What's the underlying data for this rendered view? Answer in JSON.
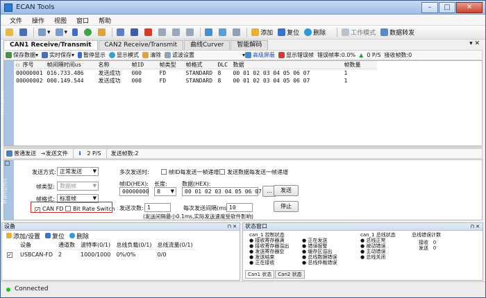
{
  "window": {
    "title": "ECAN Tools",
    "min": "–",
    "max": "□",
    "close": "✕"
  },
  "menu": [
    "文件",
    "操作",
    "视图",
    "窗口",
    "帮助"
  ],
  "toolbar": {
    "add": "添加",
    "reset": "复位",
    "delete": "删除",
    "work_mode": "工作模式",
    "data_forward": "数据转发"
  },
  "tabs": [
    "CAN1 Receive/Transmit",
    "CAN2 Receive/Transmit",
    "曲线Curver",
    "智能解码"
  ],
  "tabs_close": "▾ ✕",
  "recv_toolbar": {
    "save_data": "保存数据",
    "realtime_save": "实时保存",
    "pause": "暂停显示",
    "display_mode": "显示模式",
    "clear": "清除",
    "filter": "滤波设置",
    "advanced": "高级屏蔽",
    "show_error": "显示错误帧",
    "error_rate": "错误帧率:0.0%",
    "fps": "0 P/S",
    "recv_count": "接收帧数:0"
  },
  "recv_side": "Receive",
  "recv_table": {
    "headers": [
      "序号",
      "帧间隔时间us",
      "名称",
      "帧ID",
      "帧类型",
      "帧格式",
      "DLC",
      "数据",
      "帧数量"
    ],
    "rows": [
      [
        "00000001",
        "016.733.486",
        "发送成功",
        "000",
        "FD",
        "STANDARD",
        "8",
        "00 01 02 03 04 05 06 07",
        "1"
      ],
      [
        "00000002",
        "000.149.544",
        "发送成功",
        "000",
        "FD",
        "STANDARD",
        "8",
        "00 01 02 03 04 05 06 07",
        "1"
      ]
    ]
  },
  "send_toolbar": {
    "normal_send": "普通发送",
    "send_file": "发送文件",
    "rate": "2 P/S",
    "sent_count": "发送帧数:2"
  },
  "send_side": "Transmit",
  "send": {
    "mode_label": "发送方式:",
    "mode_value": "正常发送",
    "frame_type_label": "帧类型:",
    "frame_type_value": "数据帧",
    "frame_format_label": "帧格式:",
    "frame_format_value": "标准帧",
    "canfd_label": "CAN FD",
    "brs_label": "Bit Rate Switch",
    "multi_label": "多次发送时:",
    "id_inc_label": "帧ID每发送一帧递增",
    "data_inc_label": "发送数据每发送一帧递增",
    "frame_id_label": "帧ID(HEX):",
    "frame_id_value": "00000000",
    "length_label": "长度:",
    "length_value": "8",
    "data_label": "数据(HEX):",
    "data_value": "00 01 02 03 04 05 06 07",
    "ellipsis": "...",
    "send_button": "发送",
    "count_label": "发送次数:",
    "count_value": "1",
    "interval_label": "每次发送间隔(ms)",
    "interval_value": "10",
    "stop_button": "停止",
    "hint": "(发送间隔最小0.1ms,实际发送速度受软件影响)"
  },
  "device_panel": {
    "title": "设备",
    "add_settings": "添加/设置",
    "reset": "复位",
    "delete": "删除",
    "headers": [
      "设备",
      "通道数",
      "波特率(0/1)",
      "总线负载(0/1)",
      "总线流量(0/1)"
    ],
    "rows": [
      [
        "USBCAN-FD",
        "2",
        "1000/1000",
        "0%/0%",
        "0/0"
      ]
    ]
  },
  "status_panel": {
    "title": "状态窗口",
    "col1_title": "can_1 控制状态",
    "col1": [
      "● 接收寄存器满",
      "● 接收寄存器溢出",
      "● 发送寄存器空",
      "● 发送结束",
      "● 正在接收"
    ],
    "col2": [
      "● 正在发送",
      "● 错误报警",
      "● 缓存区溢出",
      "● 总线数据错误",
      "● 总线仲裁错误"
    ],
    "col3_title": "can_1 总线状态",
    "col3": [
      "● 总线正常",
      "● 被动错误",
      "● 主动错误",
      "● 总线关闭"
    ],
    "col4_title": "总线错误计数",
    "recv_err_label": "接收",
    "recv_err_value": "0",
    "send_err_label": "发送",
    "send_err_value": "0",
    "tabs": [
      "Can1 状态",
      "Can2 状态"
    ]
  },
  "statusbar": {
    "text": "Connected"
  },
  "icons": [
    "app-icon",
    "open-icon",
    "save-icon",
    "pause-icon",
    "clear-icon",
    "filter-icon",
    "add-icon",
    "reset-icon",
    "delete-icon"
  ]
}
